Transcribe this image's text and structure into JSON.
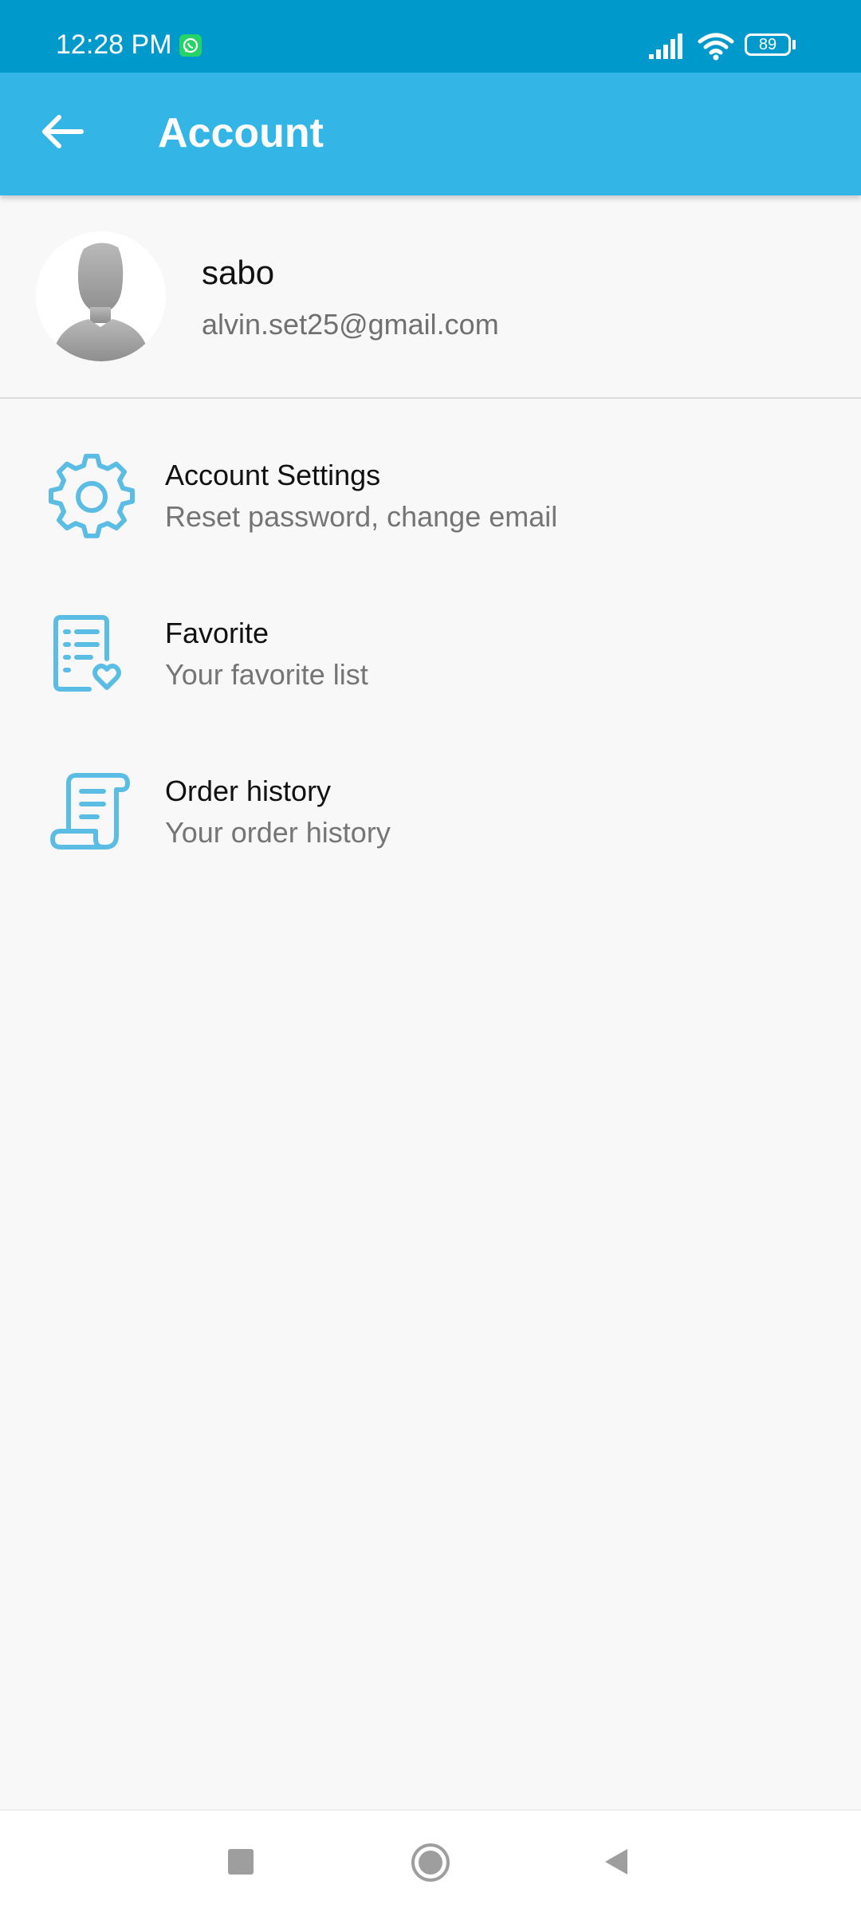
{
  "status_bar": {
    "time": "12:28 PM",
    "battery": "89",
    "icons": [
      "whatsapp-icon",
      "signal-icon",
      "wifi-icon",
      "battery-icon"
    ]
  },
  "app_bar": {
    "title": "Account",
    "back_icon": "arrow-left-icon"
  },
  "profile": {
    "name": "sabo",
    "email": "alvin.set25@gmail.com",
    "avatar_icon": "default-avatar"
  },
  "menu": [
    {
      "title": "Account Settings",
      "subtitle": "Reset password, change email",
      "icon": "gear-icon"
    },
    {
      "title": "Favorite",
      "subtitle": "Your favorite list",
      "icon": "favorite-list-icon"
    },
    {
      "title": "Order history",
      "subtitle": "Your order history",
      "icon": "receipt-scroll-icon"
    }
  ],
  "nav_bar": {
    "icons": [
      "recents-icon",
      "home-icon",
      "back-icon"
    ]
  },
  "colors": {
    "status_bar": "#0099cc",
    "app_bar": "#33b5e5",
    "icon_accent": "#5bbde4",
    "background": "#f8f8f8"
  }
}
